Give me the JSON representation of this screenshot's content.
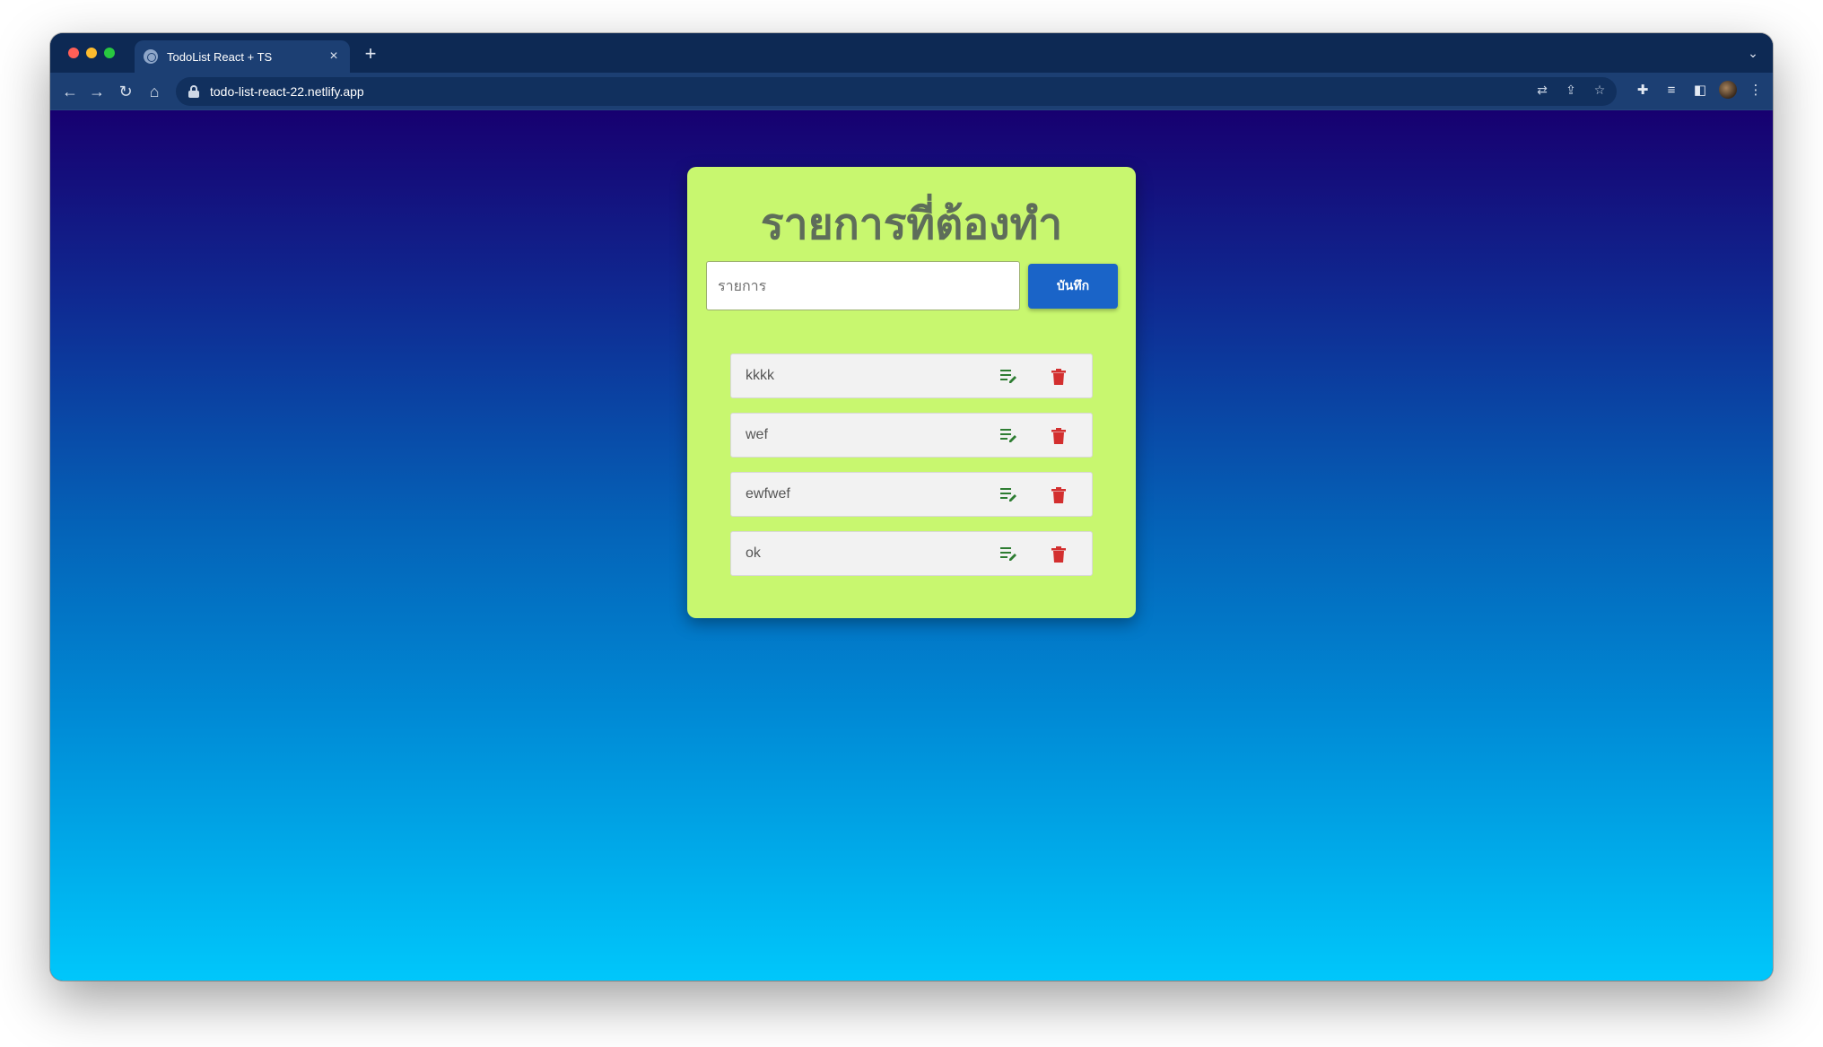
{
  "browser": {
    "tab_title": "TodoList React + TS",
    "tab_close": "×",
    "new_tab": "+",
    "url": "todo-list-react-22.netlify.app"
  },
  "app": {
    "title": "รายการที่ต้องทำ",
    "input_placeholder": "รายการ",
    "input_value": "",
    "save_label": "บันทึก"
  },
  "todos": [
    {
      "text": "kkkk"
    },
    {
      "text": "wef"
    },
    {
      "text": "ewfwef"
    },
    {
      "text": "ok"
    }
  ],
  "colors": {
    "card": "#c8f76f",
    "save_button": "#1a64c8",
    "edit_icon": "#2e7d32",
    "delete_icon": "#d32f2f"
  }
}
